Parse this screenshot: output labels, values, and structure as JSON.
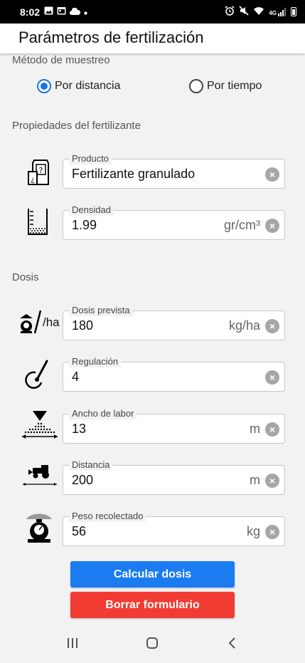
{
  "status_bar": {
    "time": "8:02",
    "left_icons": [
      "image-icon",
      "calendar-icon",
      "cloud-icon",
      "dot-icon"
    ],
    "right_icons": [
      "alarm-icon",
      "mute-icon",
      "wifi-icon",
      "4g-signal-icon",
      "battery-icon"
    ],
    "network_label": "4G"
  },
  "app_bar": {
    "title": "Parámetros de fertilización"
  },
  "sampling": {
    "title": "Método de muestreo",
    "options": [
      {
        "label": "Por distancia",
        "selected": true
      },
      {
        "label": "Por tiempo",
        "selected": false
      }
    ]
  },
  "fertilizer": {
    "title": "Propiedades del fertilizante",
    "fields": [
      {
        "label": "Producto",
        "value": "Fertilizante granulado",
        "unit": "",
        "icon": "fertilizer-bag-icon"
      },
      {
        "label": "Densidad",
        "value": "1.99",
        "unit": "gr/cm³",
        "icon": "density-container-icon"
      }
    ]
  },
  "dose": {
    "title": "Dosis",
    "icon_text": "/ha",
    "fields": [
      {
        "label": "Dosis prevista",
        "value": "180",
        "unit": "kg/ha",
        "icon": "scale-per-hectare-icon"
      },
      {
        "label": "Regulación",
        "value": "4",
        "unit": "",
        "icon": "regulation-dial-icon"
      },
      {
        "label": "Ancho de labor",
        "value": "13",
        "unit": "m",
        "icon": "spread-width-icon"
      },
      {
        "label": "Distancia",
        "value": "200",
        "unit": "m",
        "icon": "tractor-distance-icon"
      },
      {
        "label": "Peso recolectado",
        "value": "56",
        "unit": "kg",
        "icon": "weighing-scale-icon"
      }
    ]
  },
  "buttons": {
    "calculate": "Calcular dosis",
    "clear": "Borrar formulario"
  },
  "colors": {
    "accent": "#1a73e8",
    "calculate_button": "#1a7cf0",
    "clear_button": "#f03c32",
    "background": "#f2f2f2"
  },
  "nav_bar": {
    "icons": [
      "recent-apps-icon",
      "home-icon",
      "back-icon"
    ]
  }
}
